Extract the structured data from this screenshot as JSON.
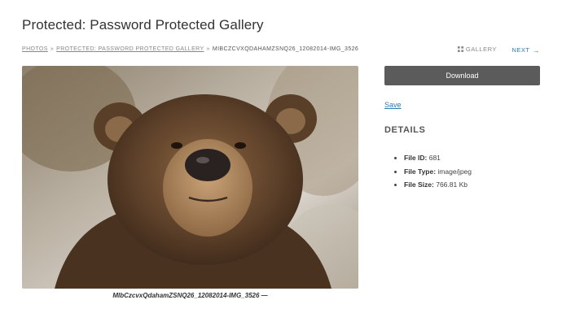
{
  "page": {
    "title": "Protected: Password Protected Gallery"
  },
  "breadcrumb": {
    "items": [
      "PHOTOS",
      "PROTECTED: PASSWORD PROTECTED GALLERY",
      "MIBCZCVXQDAHAMZSNQ26_12082014-IMG_3526"
    ],
    "separator": "»"
  },
  "nav": {
    "gallery_label": "GALLERY",
    "next_label": "NEXT",
    "icons": [
      "grid-icon",
      "arrow-right-icon"
    ],
    "accent_color": "#2b7bb8"
  },
  "photo": {
    "caption": "MIbCzcvxQdahamZSNQ26_12082014-IMG_3526 —"
  },
  "sidebar": {
    "download_label": "Download",
    "save_label": "Save",
    "details_heading": "DETAILS",
    "details": [
      {
        "label": "File ID:",
        "value": "681"
      },
      {
        "label": "File Type:",
        "value": "image/jpeg"
      },
      {
        "label": "File Size:",
        "value": "766.81 Kb"
      }
    ],
    "button_color": "#5b5b5b"
  }
}
